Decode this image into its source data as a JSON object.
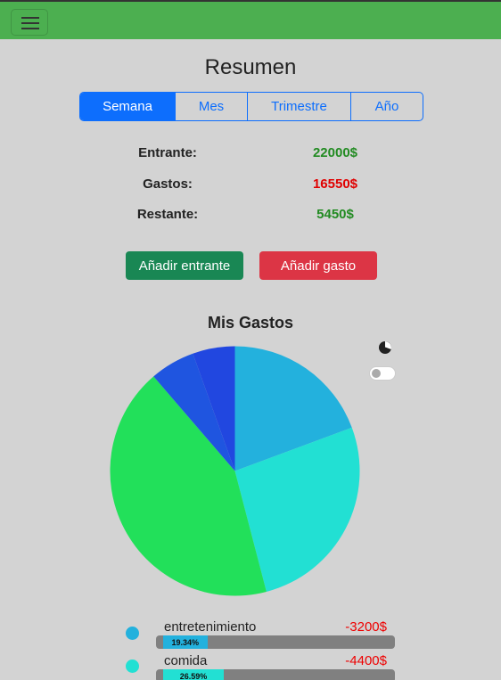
{
  "header": {
    "menu_icon": "hamburger-icon"
  },
  "title": "Resumen",
  "tabs": [
    {
      "label": "Semana",
      "active": true
    },
    {
      "label": "Mes",
      "active": false
    },
    {
      "label": "Trimestre",
      "active": false
    },
    {
      "label": "Año",
      "active": false
    }
  ],
  "summary": [
    {
      "label": "Entrante:",
      "value": "22000$",
      "color": "#228b22"
    },
    {
      "label": "Gastos:",
      "value": "16550$",
      "color": "#e00000"
    },
    {
      "label": "Restante:",
      "value": "5450$",
      "color": "#228b22"
    }
  ],
  "actions": {
    "add_income": "Añadir entrante",
    "add_expense": "Añadir gasto"
  },
  "chart_title": "Mis Gastos",
  "chart_controls": {
    "chart_icon": "pie-chart-icon",
    "toggle_on": false
  },
  "chart_data": {
    "type": "pie",
    "slices": [
      {
        "color": "#23b1dd",
        "fraction": 0.1934
      },
      {
        "color": "#22e0d3",
        "fraction": 0.2659
      },
      {
        "color": "#22e05a",
        "fraction": 0.4277
      },
      {
        "color": "#1f55e0",
        "fraction": 0.0583
      },
      {
        "color": "#2147e0",
        "fraction": 0.0547
      }
    ]
  },
  "legend": [
    {
      "name": "entretenimiento",
      "amount": "-3200$",
      "percent": "19.34%",
      "fraction": 0.1934,
      "color": "#23b1dd"
    },
    {
      "name": "comida",
      "amount": "-4400$",
      "percent": "26.59%",
      "fraction": 0.2659,
      "color": "#22e0d3"
    }
  ]
}
